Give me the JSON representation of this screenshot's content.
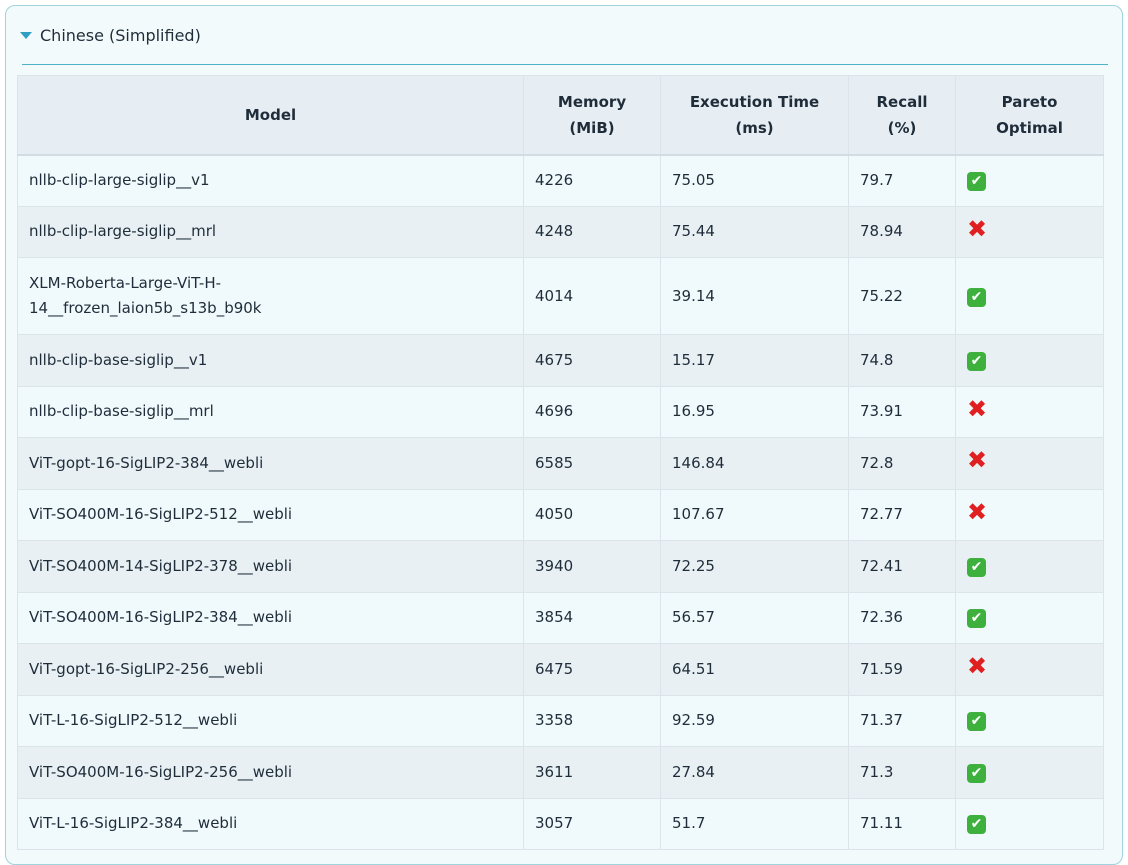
{
  "section": {
    "title": "Chinese (Simplified)"
  },
  "table": {
    "headers": {
      "model": "Model",
      "memory_l1": "Memory",
      "memory_l2": "(MiB)",
      "exec_l1": "Execution Time",
      "exec_l2": "(ms)",
      "recall_l1": "Recall",
      "recall_l2": "(%)",
      "pareto_l1": "Pareto",
      "pareto_l2": "Optimal"
    },
    "rows": [
      {
        "model": "nllb-clip-large-siglip__v1",
        "memory": "4226",
        "exec": "75.05",
        "recall": "79.7",
        "pareto": "✔"
      },
      {
        "model": "nllb-clip-large-siglip__mrl",
        "memory": "4248",
        "exec": "75.44",
        "recall": "78.94",
        "pareto": "✖"
      },
      {
        "model": "XLM-Roberta-Large-ViT-H-14__frozen_laion5b_s13b_b90k",
        "model_l1": "XLM-Roberta-Large-ViT-H-",
        "model_l2": "14__frozen_laion5b_s13b_b90k",
        "memory": "4014",
        "exec": "39.14",
        "recall": "75.22",
        "pareto": "✔"
      },
      {
        "model": "nllb-clip-base-siglip__v1",
        "memory": "4675",
        "exec": "15.17",
        "recall": "74.8",
        "pareto": "✔"
      },
      {
        "model": "nllb-clip-base-siglip__mrl",
        "memory": "4696",
        "exec": "16.95",
        "recall": "73.91",
        "pareto": "✖"
      },
      {
        "model": "ViT-gopt-16-SigLIP2-384__webli",
        "memory": "6585",
        "exec": "146.84",
        "recall": "72.8",
        "pareto": "✖"
      },
      {
        "model": "ViT-SO400M-16-SigLIP2-512__webli",
        "memory": "4050",
        "exec": "107.67",
        "recall": "72.77",
        "pareto": "✖"
      },
      {
        "model": "ViT-SO400M-14-SigLIP2-378__webli",
        "memory": "3940",
        "exec": "72.25",
        "recall": "72.41",
        "pareto": "✔"
      },
      {
        "model": "ViT-SO400M-16-SigLIP2-384__webli",
        "memory": "3854",
        "exec": "56.57",
        "recall": "72.36",
        "pareto": "✔"
      },
      {
        "model": "ViT-gopt-16-SigLIP2-256__webli",
        "memory": "6475",
        "exec": "64.51",
        "recall": "71.59",
        "pareto": "✖"
      },
      {
        "model": "ViT-L-16-SigLIP2-512__webli",
        "memory": "3358",
        "exec": "92.59",
        "recall": "71.37",
        "pareto": "✔"
      },
      {
        "model": "ViT-SO400M-16-SigLIP2-256__webli",
        "memory": "3611",
        "exec": "27.84",
        "recall": "71.3",
        "pareto": "✔"
      },
      {
        "model": "ViT-L-16-SigLIP2-384__webli",
        "memory": "3057",
        "exec": "51.7",
        "recall": "71.11",
        "pareto": "✔"
      }
    ]
  },
  "icons": {
    "expanded": "triangle-down-icon",
    "pareto_yes": "check-mark-icon",
    "pareto_no": "cross-mark-icon"
  },
  "colors": {
    "accent": "#2e9fc0",
    "check": "#3db03d",
    "cross": "#e02020"
  }
}
